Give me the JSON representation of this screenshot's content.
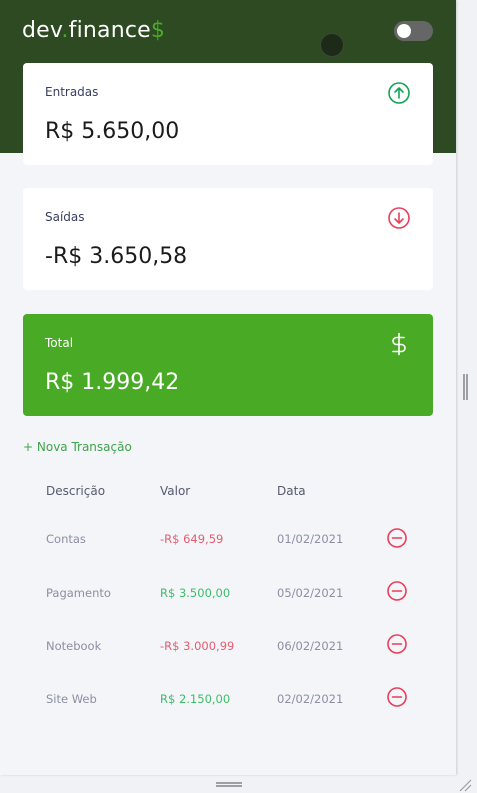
{
  "header": {
    "logo_main": "dev",
    "logo_dot": ".",
    "logo_rest": "finance",
    "logo_symbol": "$",
    "theme_toggle_on": false
  },
  "cards": {
    "income": {
      "label": "Entradas",
      "value": "R$ 5.650,00",
      "icon": "arrow-up-circle-icon"
    },
    "expense": {
      "label": "Saídas",
      "value": "-R$ 3.650,58",
      "icon": "arrow-down-circle-icon"
    },
    "total": {
      "label": "Total",
      "value": "R$ 1.999,42",
      "icon": "dollar-icon"
    }
  },
  "new_transaction_label": "+ Nova Transação",
  "table": {
    "headers": [
      "Descrição",
      "Valor",
      "Data"
    ],
    "rows": [
      {
        "description": "Contas",
        "amount": "-R$ 649,59",
        "type": "expense",
        "date": "01/02/2021"
      },
      {
        "description": "Pagamento",
        "amount": "R$ 3.500,00",
        "type": "income",
        "date": "05/02/2021"
      },
      {
        "description": "Notebook",
        "amount": "-R$ 3.000,99",
        "type": "expense",
        "date": "06/02/2021"
      },
      {
        "description": "Site Web",
        "amount": "R$ 2.150,00",
        "type": "income",
        "date": "02/02/2021"
      }
    ]
  },
  "colors": {
    "header_bg": "#2d4a22",
    "accent_green": "#49aa26",
    "income_text": "#3dbd69",
    "expense_text": "#e65c70",
    "page_bg": "#f4f5f8"
  }
}
